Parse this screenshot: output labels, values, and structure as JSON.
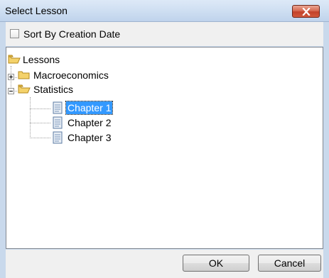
{
  "window": {
    "title": "Select Lesson",
    "close_icon": "close-icon"
  },
  "options": {
    "sort_label": "Sort By Creation Date",
    "sort_checked": false
  },
  "tree": {
    "root": "Lessons",
    "macro": "Macroeconomics",
    "stats": "Statistics",
    "chapters": [
      "Chapter 1",
      "Chapter 2",
      "Chapter 3"
    ],
    "selected": "Chapter 1"
  },
  "buttons": {
    "ok": "OK",
    "cancel": "Cancel"
  },
  "colors": {
    "selection": "#3399ff",
    "close_button": "#c34129",
    "folder": "#f4d26b"
  }
}
